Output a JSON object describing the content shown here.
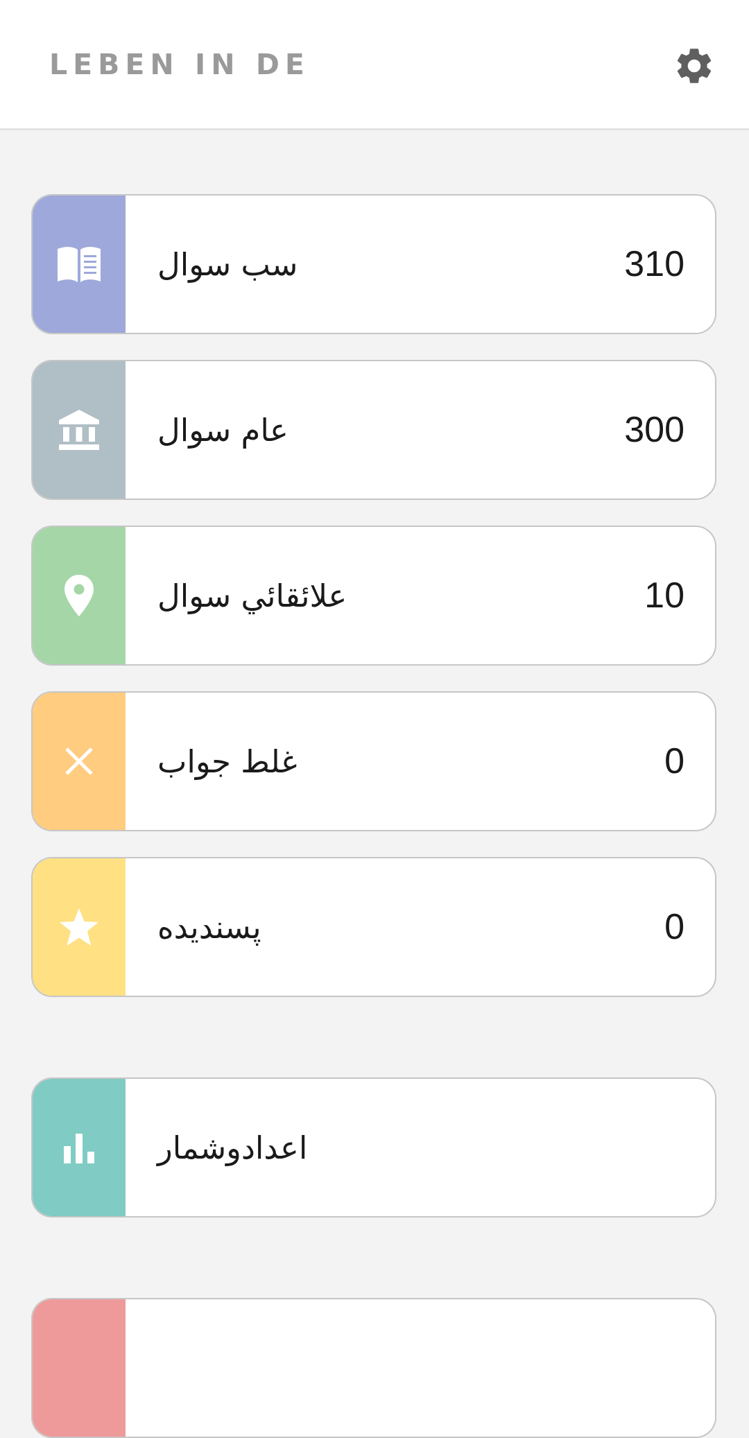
{
  "header": {
    "title": "LEBEN IN DE",
    "settings_icon": "gear-icon"
  },
  "colors": {
    "all": "#9fa8da",
    "general": "#b0bec5",
    "regional": "#a5d6a7",
    "wrong": "#ffcc80",
    "favorites": "#ffe082",
    "statistics": "#80cbc4",
    "bottom": "#ef9a9a"
  },
  "menu": {
    "all_questions": {
      "label": "سب سوال",
      "count": "310",
      "icon": "book-icon"
    },
    "general_questions": {
      "label": "عام سوال",
      "count": "300",
      "icon": "bank-icon"
    },
    "regional_questions": {
      "label": "علائقائي سوال",
      "count": "10",
      "icon": "location-pin-icon"
    },
    "wrong_answers": {
      "label": "غلط جواب",
      "count": "0",
      "icon": "close-icon"
    },
    "favorites": {
      "label": "پسنديده",
      "count": "0",
      "icon": "star-icon"
    },
    "statistics": {
      "label": "اعدادوشمار",
      "icon": "bar-chart-icon"
    }
  }
}
